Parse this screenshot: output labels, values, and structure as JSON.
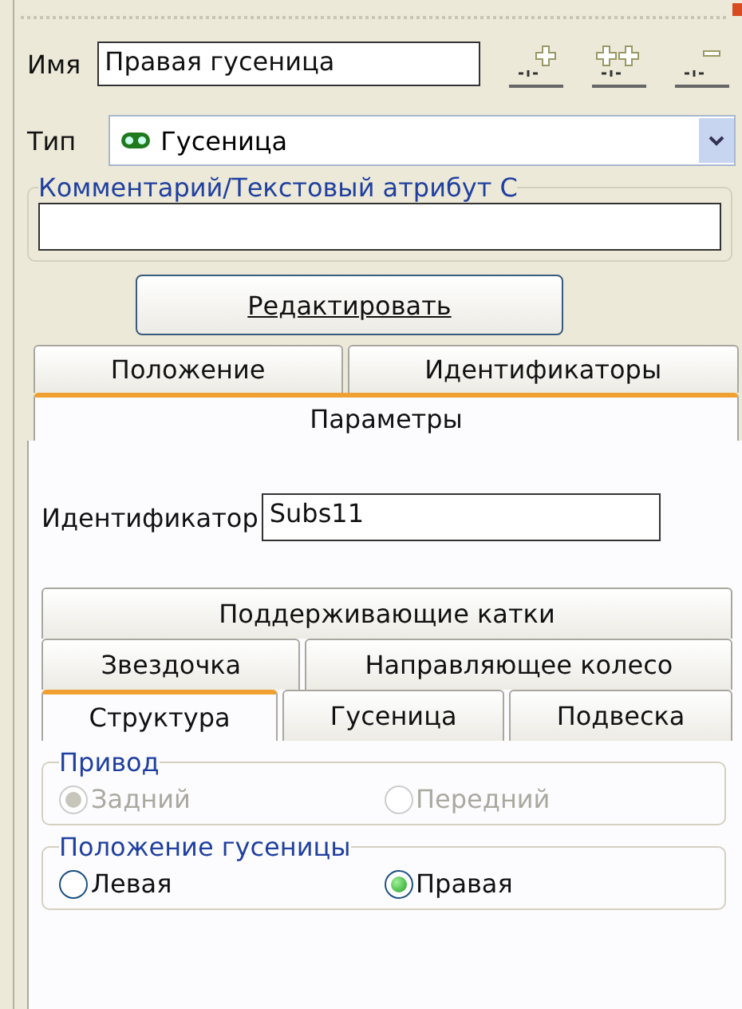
{
  "name_field": {
    "label": "Имя",
    "value": "Правая гусеница"
  },
  "type_field": {
    "label": "Тип",
    "value": "Гусеница"
  },
  "comment": {
    "legend": "Комментарий/Текстовый атрибут С"
  },
  "edit_button": {
    "label": "Редактировать"
  },
  "tab_rows": [
    [
      {
        "label": "Положение",
        "selected": false
      },
      {
        "label": "Идентификаторы",
        "selected": false
      }
    ],
    [
      {
        "label": "Параметры",
        "selected": true
      }
    ]
  ],
  "identifier": {
    "label": "Идентификатор",
    "value": "Subs11"
  },
  "inner_tab_rows": [
    [
      {
        "label": "Поддерживающие катки",
        "selected": false
      }
    ],
    [
      {
        "label": "Звездочка",
        "selected": false
      },
      {
        "label": "Направляющее колесо",
        "selected": false
      }
    ],
    [
      {
        "label": "Структура",
        "selected": true
      },
      {
        "label": "Гусеница",
        "selected": false
      },
      {
        "label": "Подвеска",
        "selected": false
      }
    ]
  ],
  "groups": [
    {
      "legend": "Привод",
      "options": [
        {
          "label": "Задний",
          "selected": true,
          "disabled": true
        },
        {
          "label": "Передний",
          "selected": false,
          "disabled": true
        }
      ]
    },
    {
      "legend": "Положение гусеницы",
      "options": [
        {
          "label": "Левая",
          "selected": false,
          "disabled": false
        },
        {
          "label": "Правая",
          "selected": true,
          "disabled": false
        }
      ]
    }
  ]
}
